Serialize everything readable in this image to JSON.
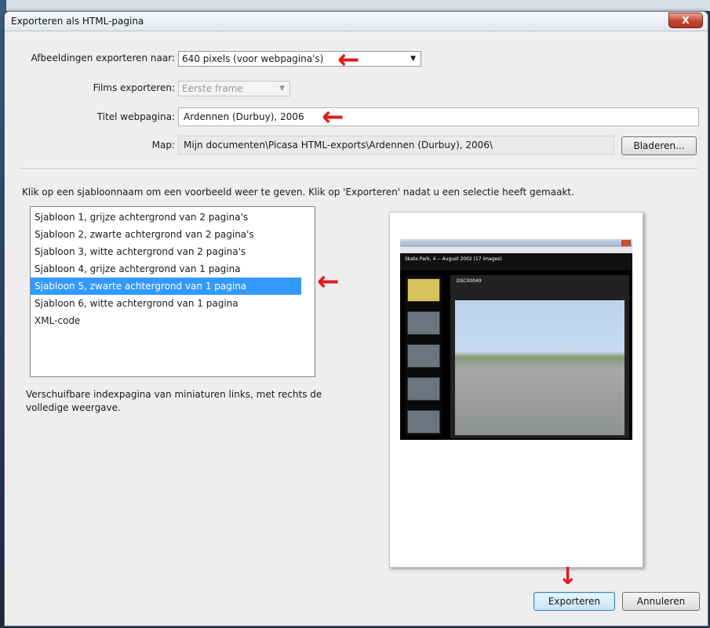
{
  "window": {
    "title": "Exporteren als HTML-pagina",
    "close_glyph": "X"
  },
  "form": {
    "export_images": {
      "label": "Afbeeldingen exporteren naar:",
      "value": "640 pixels (voor webpagina's)"
    },
    "export_films": {
      "label": "Films exporteren:",
      "value": "Eerste frame"
    },
    "page_title": {
      "label": "Titel webpagina:",
      "value": "Ardennen (Durbuy), 2006"
    },
    "folder": {
      "label": "Map:",
      "value": "Mijn documenten\\Picasa HTML-exports\\Ardennen (Durbuy), 2006\\",
      "browse_label": "Bladeren..."
    }
  },
  "instruction": "Klik op een sjabloonnaam om een voorbeeld weer te geven. Klik op 'Exporteren' nadat u een selectie heeft gemaakt.",
  "templates": [
    {
      "label": "Sjabloon 1, grijze achtergrond van 2 pagina's"
    },
    {
      "label": "Sjabloon 2, zwarte achtergrond van 2 pagina's"
    },
    {
      "label": "Sjabloon 3, witte achtergrond van 2 pagina's"
    },
    {
      "label": "Sjabloon 4, grijze achtergrond van 1 pagina"
    },
    {
      "label": "Sjabloon 5, zwarte achtergrond van 1 pagina"
    },
    {
      "label": "Sjabloon 6, witte achtergrond van 1 pagina"
    },
    {
      "label": "XML-code"
    }
  ],
  "selected_template_index": 4,
  "description": "Verschuifbare indexpagina van miniaturen links, met rechts de volledige weergave.",
  "preview": {
    "heading": "Skate Park, 4 -- August 2002 (17 images)",
    "caption": "DSC00049"
  },
  "buttons": {
    "export": "Exporteren",
    "cancel": "Annuleren"
  },
  "annotations": {
    "arrow_color": "#e11b1b"
  },
  "colors": {
    "selection": "#3399ff",
    "close_button": "#c4442f"
  }
}
